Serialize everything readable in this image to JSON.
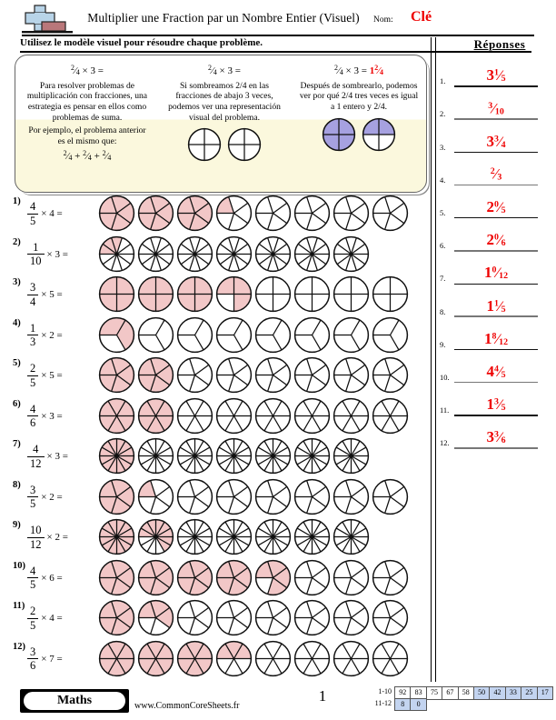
{
  "header": {
    "title": "Multiplier une Fraction par un Nombre Entier (Visuel)",
    "name_label": "Nom:",
    "name_value": "Clé",
    "instruction": "Utilisez le modèle visuel pour résoudre chaque problème.",
    "logo_icon": "plus-block-logo"
  },
  "example": {
    "panel1": {
      "equation_num": "2",
      "equation_den": "4",
      "equation_rest": "× 3 =",
      "text": "Para resolver problemas de multiplicación con fracciones, una estrategia es pensar en ellos como problemas de suma.",
      "text2": "Por ejemplo, el problema anterior es el mismo que:",
      "sum_line": "2/4 + 2/4 + 2/4"
    },
    "panel2": {
      "equation_num": "2",
      "equation_den": "4",
      "equation_rest": "× 3 =",
      "text": "Si sombreamos 2/4 en las fracciones de abajo 3 veces, podemos ver una representación visual del problema.",
      "circles": [
        {
          "sectors": 4,
          "shaded": 0
        },
        {
          "sectors": 4,
          "shaded": 0
        }
      ]
    },
    "panel3": {
      "equation_num": "2",
      "equation_den": "4",
      "equation_rest": "× 3 =",
      "answer_whole": "1",
      "answer_num": "2",
      "answer_den": "4",
      "text": "Después de sombrearlo, podemos ver por qué 2/4 tres veces es igual a 1 entero y 2/4.",
      "circles": [
        {
          "sectors": 4,
          "shaded": 4
        },
        {
          "sectors": 4,
          "shaded": 2
        }
      ],
      "shade_color": "#a6a1e0"
    }
  },
  "problems": [
    {
      "num": "1)",
      "numerator": "4",
      "denominator": "5",
      "multiplier": "× 4 =",
      "sectors": 5,
      "total_shaded": 16,
      "circles": 8
    },
    {
      "num": "2)",
      "numerator": "1",
      "denominator": "10",
      "multiplier": "× 3 =",
      "sectors": 10,
      "total_shaded": 3,
      "circles": 7
    },
    {
      "num": "3)",
      "numerator": "3",
      "denominator": "4",
      "multiplier": "× 5 =",
      "sectors": 4,
      "total_shaded": 15,
      "circles": 8
    },
    {
      "num": "4)",
      "numerator": "1",
      "denominator": "3",
      "multiplier": "× 2 =",
      "sectors": 3,
      "total_shaded": 2,
      "circles": 8
    },
    {
      "num": "5)",
      "numerator": "2",
      "denominator": "5",
      "multiplier": "× 5 =",
      "sectors": 5,
      "total_shaded": 10,
      "circles": 8
    },
    {
      "num": "6)",
      "numerator": "4",
      "denominator": "6",
      "multiplier": "× 3 =",
      "sectors": 6,
      "total_shaded": 12,
      "circles": 8
    },
    {
      "num": "7)",
      "numerator": "4",
      "denominator": "12",
      "multiplier": "× 3 =",
      "sectors": 12,
      "total_shaded": 12,
      "circles": 7
    },
    {
      "num": "8)",
      "numerator": "3",
      "denominator": "5",
      "multiplier": "× 2 =",
      "sectors": 5,
      "total_shaded": 6,
      "circles": 8
    },
    {
      "num": "9)",
      "numerator": "10",
      "denominator": "12",
      "multiplier": "× 2 =",
      "sectors": 12,
      "total_shaded": 20,
      "circles": 7
    },
    {
      "num": "10)",
      "numerator": "4",
      "denominator": "5",
      "multiplier": "× 6 =",
      "sectors": 5,
      "total_shaded": 24,
      "circles": 8
    },
    {
      "num": "11)",
      "numerator": "2",
      "denominator": "5",
      "multiplier": "× 4 =",
      "sectors": 5,
      "total_shaded": 8,
      "circles": 8
    },
    {
      "num": "12)",
      "numerator": "3",
      "denominator": "6",
      "multiplier": "× 7 =",
      "sectors": 6,
      "total_shaded": 21,
      "circles": 8
    }
  ],
  "answers": {
    "title": "Réponses",
    "color": "#ee0000",
    "items": [
      {
        "num": "1.",
        "whole": "3",
        "n": "1",
        "d": "5"
      },
      {
        "num": "2.",
        "whole": "",
        "n": "3",
        "d": "10"
      },
      {
        "num": "3.",
        "whole": "3",
        "n": "3",
        "d": "4"
      },
      {
        "num": "4.",
        "whole": "",
        "n": "2",
        "d": "3"
      },
      {
        "num": "5.",
        "whole": "2",
        "n": "0",
        "d": "5"
      },
      {
        "num": "6.",
        "whole": "2",
        "n": "0",
        "d": "6"
      },
      {
        "num": "7.",
        "whole": "1",
        "n": "0",
        "d": "12"
      },
      {
        "num": "8.",
        "whole": "1",
        "n": "1",
        "d": "5"
      },
      {
        "num": "9.",
        "whole": "1",
        "n": "8",
        "d": "12"
      },
      {
        "num": "10.",
        "whole": "4",
        "n": "4",
        "d": "5"
      },
      {
        "num": "11.",
        "whole": "1",
        "n": "3",
        "d": "5"
      },
      {
        "num": "12.",
        "whole": "3",
        "n": "3",
        "d": "6"
      }
    ]
  },
  "footer": {
    "subject": "Maths",
    "site": "www.CommonCoreSheets.fr",
    "page": "1",
    "score_rows": [
      {
        "label": "1-10",
        "cells": [
          {
            "v": "92",
            "hl": false
          },
          {
            "v": "83",
            "hl": false
          },
          {
            "v": "75",
            "hl": false
          },
          {
            "v": "67",
            "hl": false
          },
          {
            "v": "58",
            "hl": false
          },
          {
            "v": "50",
            "hl": true
          },
          {
            "v": "42",
            "hl": true
          },
          {
            "v": "33",
            "hl": true
          },
          {
            "v": "25",
            "hl": true
          },
          {
            "v": "17",
            "hl": true
          }
        ]
      },
      {
        "label": "11-12",
        "cells": [
          {
            "v": "8",
            "hl": true
          },
          {
            "v": "0",
            "hl": true
          }
        ]
      }
    ],
    "highlight_color": "#c3d4f0"
  },
  "colors": {
    "problem_shade": "#f2c7c7",
    "example_shade": "#a6a1e0",
    "answer_red": "#ee0000",
    "box_bg": "#fbf8dd"
  }
}
